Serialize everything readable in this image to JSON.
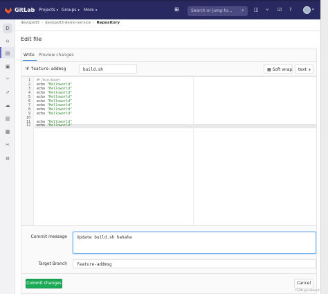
{
  "topbar": {
    "brand": "GitLab",
    "nav": [
      {
        "label": "Projects"
      },
      {
        "label": "Groups"
      },
      {
        "label": "More"
      }
    ],
    "search_placeholder": "Search or jump to...",
    "colors": {
      "navbar": "#292961",
      "accent": "#1f78d1",
      "commit": "#1aaa55"
    }
  },
  "sidebar": {
    "project_initial": "D",
    "icons": [
      "project-overview-icon",
      "repository-icon",
      "issues-icon",
      "merge-requests-icon",
      "ci-cd-icon",
      "operations-icon",
      "analytics-icon",
      "wiki-icon",
      "snippets-icon",
      "settings-icon"
    ]
  },
  "breadcrumb": {
    "items": [
      "devops03",
      "devops03-demo-service",
      "Repository"
    ]
  },
  "page": {
    "title": "Edit file"
  },
  "tabs": [
    {
      "label": "Write",
      "active": true
    },
    {
      "label": "Preview changes",
      "active": false
    }
  ],
  "file": {
    "branch": "feature-addmsg",
    "filename": "build.sh",
    "soft_wrap": "Soft wrap",
    "language": "text"
  },
  "editor": {
    "current_line": 12,
    "lines": [
      {
        "n": "1",
        "prefix": "#!/bin/bash",
        "str": "",
        "type": "comment"
      },
      {
        "n": "2",
        "prefix": "echo ",
        "str": "\"Helloworld\"",
        "type": "code"
      },
      {
        "n": "3",
        "prefix": "echo ",
        "str": "\"Helloworld\"",
        "type": "code"
      },
      {
        "n": "4",
        "prefix": "echo ",
        "str": "\"Helloworld\"",
        "type": "code"
      },
      {
        "n": "5",
        "prefix": "echo ",
        "str": "\"Helloworld\"",
        "type": "code"
      },
      {
        "n": "6",
        "prefix": "echo ",
        "str": "\"Helloworld\"",
        "type": "code"
      },
      {
        "n": "7",
        "prefix": "echo ",
        "str": "\"Helloworld\"",
        "type": "code"
      },
      {
        "n": "8",
        "prefix": "echo ",
        "str": "\"Helloworld\"",
        "type": "code"
      },
      {
        "n": "9",
        "prefix": "echo ",
        "str": "\"Helloworld\"",
        "type": "code"
      },
      {
        "n": "10",
        "prefix": "",
        "str": "",
        "type": "code"
      },
      {
        "n": "11",
        "prefix": "echo ",
        "str": "\"Helloworld\"",
        "type": "code"
      },
      {
        "n": "12",
        "prefix": "echo ",
        "str": "\"Helloworld\"",
        "type": "code"
      }
    ]
  },
  "commit": {
    "message_label": "Commit message",
    "message_value": "Update build.sh  hahaha",
    "target_label": "Target Branch",
    "target_value": "feature-addmsg",
    "commit_button": "Commit changes",
    "cancel_button": "Cancel"
  },
  "watermark": "CSDN @cookbeck"
}
